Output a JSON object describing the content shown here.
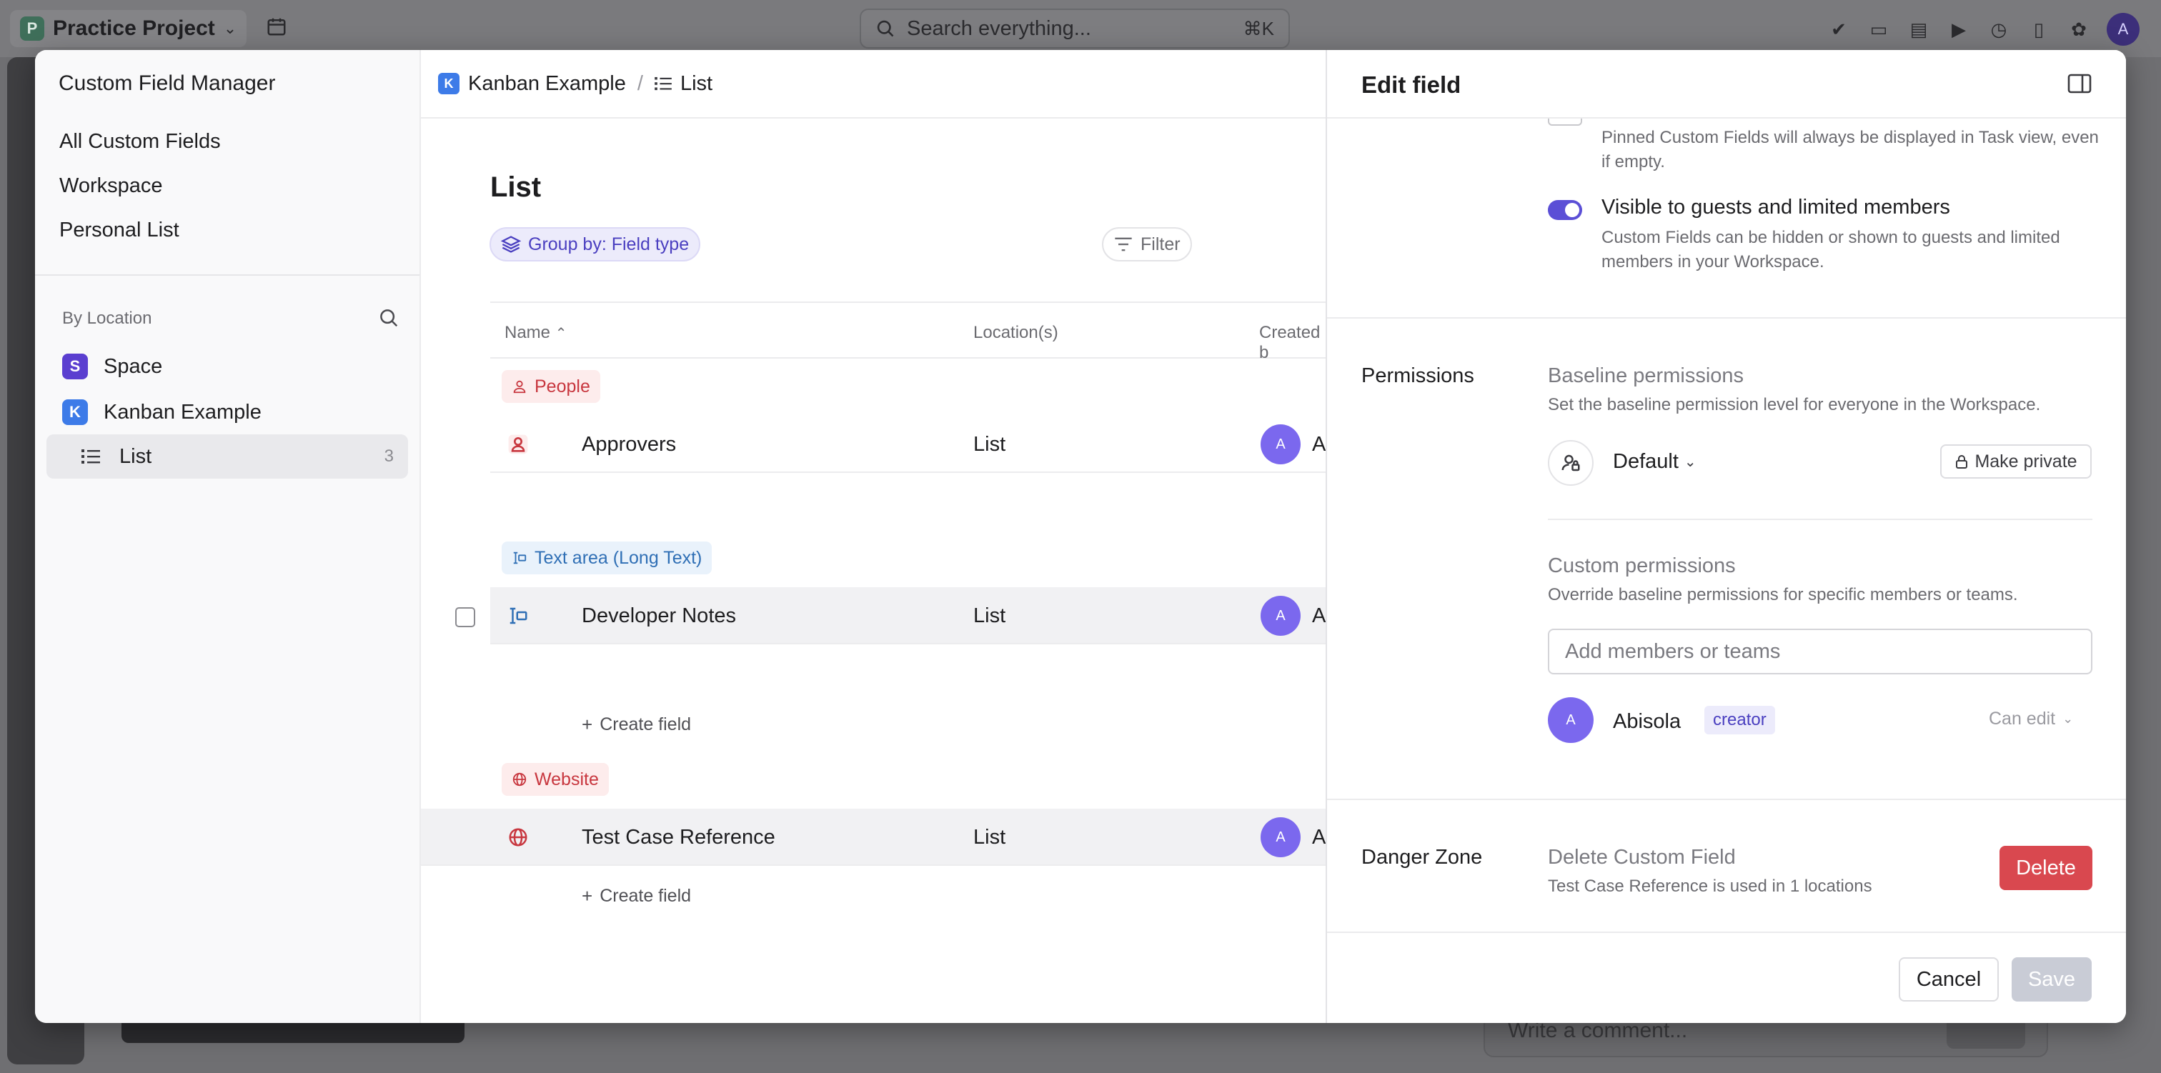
{
  "topbar": {
    "workspace_initial": "P",
    "workspace_name": "Practice Project",
    "search_placeholder": "Search everything...",
    "search_shortcut": "⌘K",
    "avatar_initial": "A"
  },
  "background": {
    "comment_placeholder": "Write a comment..."
  },
  "sidebar": {
    "title": "Custom Field Manager",
    "nav": [
      "All Custom Fields",
      "Workspace",
      "Personal List"
    ],
    "section_label": "By Location",
    "locations": [
      {
        "badge": "S",
        "name": "Space",
        "color": "#5b3fd0"
      },
      {
        "badge": "K",
        "name": "Kanban Example",
        "color": "#3d7be8"
      },
      {
        "name": "List",
        "count": "3"
      }
    ]
  },
  "main": {
    "breadcrumb": {
      "badge": "K",
      "space": "Kanban Example",
      "sep": "/",
      "list": "List"
    },
    "heading": "List",
    "group_by": "Group by: Field type",
    "filter": "Filter",
    "columns": {
      "name": "Name",
      "location": "Location(s)",
      "created_by": "Created b"
    },
    "create_field": "Create field",
    "groups": [
      {
        "label": "People",
        "color": "#c8373f",
        "bg": "#fdecec"
      },
      {
        "label": "Text area (Long Text)",
        "color": "#2f6fb5",
        "bg": "#e9f2fb"
      },
      {
        "label": "Website",
        "color": "#c8373f",
        "bg": "#fdecec"
      }
    ],
    "fields": [
      {
        "name": "Approvers",
        "location": "List",
        "avatar": "A",
        "creator": "Ab"
      },
      {
        "name": "Developer Notes",
        "location": "List",
        "avatar": "A",
        "creator": "Abi"
      },
      {
        "name": "Test Case Reference",
        "location": "List",
        "avatar": "A",
        "creator": "Ab"
      }
    ]
  },
  "edit": {
    "title": "Edit field",
    "pinned_desc": "Pinned Custom Fields will always be displayed in Task view, even if empty.",
    "visible_label": "Visible to guests and limited members",
    "visible_desc": "Custom Fields can be hidden or shown to guests and limited members in your Workspace.",
    "visible_on": true,
    "permissions": {
      "label": "Permissions",
      "baseline_title": "Baseline permissions",
      "baseline_desc": "Set the baseline permission level for everyone in the Workspace.",
      "default_label": "Default",
      "make_private": "Make private",
      "custom_title": "Custom permissions",
      "custom_desc": "Override baseline permissions for specific members or teams.",
      "add_placeholder": "Add members or teams",
      "member": {
        "initial": "A",
        "name": "Abisola",
        "badge": "creator",
        "access": "Can edit"
      }
    },
    "danger": {
      "label": "Danger Zone",
      "title": "Delete Custom Field",
      "desc": "Test Case Reference is used in 1 locations",
      "delete": "Delete"
    },
    "cancel": "Cancel",
    "save": "Save"
  }
}
